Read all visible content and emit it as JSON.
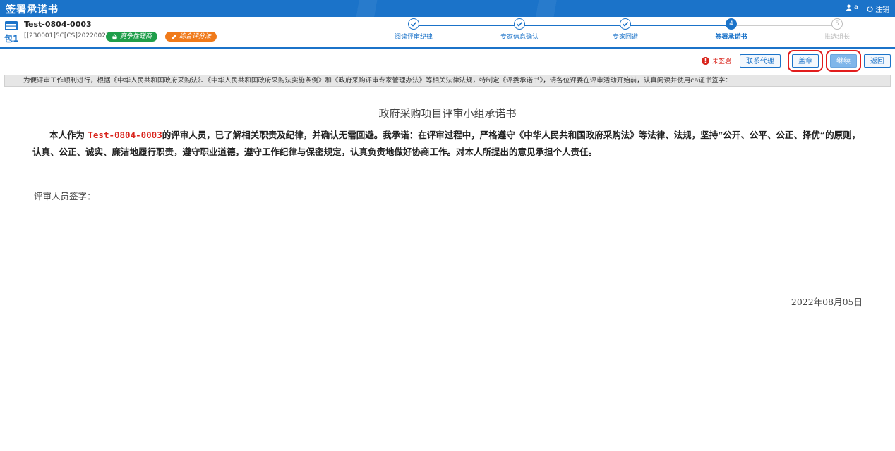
{
  "app": {
    "title": "签署承诺书",
    "user": "a",
    "logout": "注销"
  },
  "project": {
    "package": "包1",
    "name": "Test-0804-0003",
    "code": "[[230001]SC[CS]20220027",
    "badges": [
      "竞争性磋商",
      "综合评分法"
    ]
  },
  "steps": [
    {
      "num": "",
      "label": "阅读评审纪律",
      "state": "done"
    },
    {
      "num": "",
      "label": "专家信息确认",
      "state": "done"
    },
    {
      "num": "",
      "label": "专家回避",
      "state": "done"
    },
    {
      "num": "4",
      "label": "签署承诺书",
      "state": "active"
    },
    {
      "num": "5",
      "label": "推选组长",
      "state": "pending"
    }
  ],
  "toolbar": {
    "status": "未签署",
    "contact_agent": "联系代理",
    "stamp": "盖章",
    "continue": "继续",
    "back": "返回"
  },
  "notice": "为便评审工作顺利进行，根据《中华人民共和国政府采购法》、《中华人民共和国政府采购法实施条例》和《政府采购评审专家管理办法》等相关法律法规，特制定《评委承诺书》，请各位评委在评审活动开始前，认真阅读并使用ca证书签字：",
  "document": {
    "title": "政府采购项目评审小组承诺书",
    "body_prefix": "本人作为",
    "project_ref": "Test-0804-0003",
    "body_suffix": "的评审人员，已了解相关职责及纪律，并确认无需回避。我承诺：在评审过程中，严格遵守《中华人民共和国政府采购法》等法律、法规，坚持“公开、公平、公正、择优”的原则，认真、公正、诚实、廉洁地履行职责，遵守职业道德，遵守工作纪律与保密规定，认真负责地做好协商工作。对本人所提出的意见承担个人责任。",
    "sign_label": "评审人员签字：",
    "date": "2022年08月05日"
  },
  "colors": {
    "brand": "#1b73c9",
    "alert": "#d9251d",
    "badge_green": "#1f9e4a",
    "badge_orange": "#f07a1a"
  }
}
